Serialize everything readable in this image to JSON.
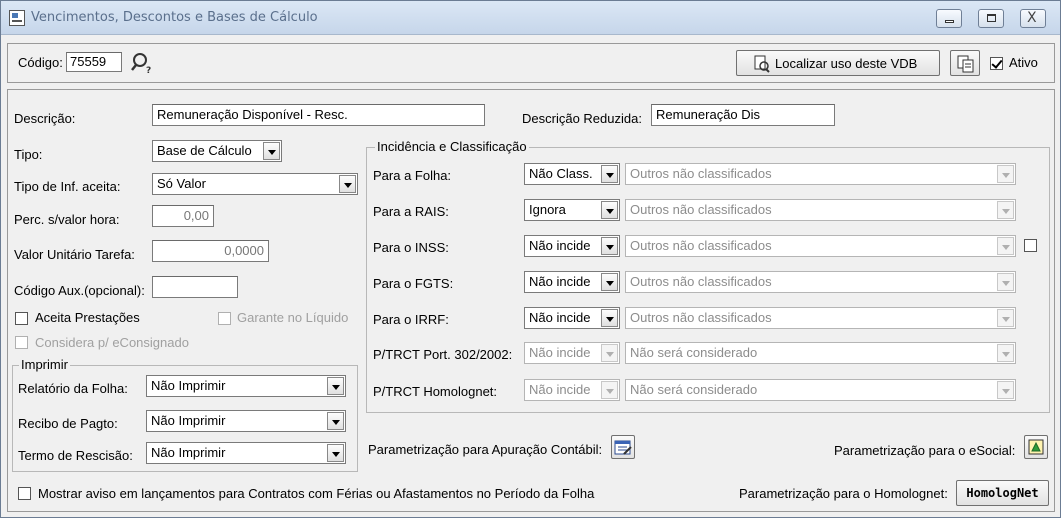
{
  "window": {
    "title": "Vencimentos, Descontos e Bases de Cálculo",
    "minimize": "",
    "maximize": "",
    "close": "X"
  },
  "top": {
    "codigo_label": "Código:",
    "codigo_value": "75559",
    "localizar_label": "Localizar uso deste VDB",
    "ativo_label": "Ativo"
  },
  "form": {
    "descricao_label": "Descrição:",
    "descricao_value": "Remuneração Disponível - Resc.",
    "desc_reduzida_label": "Descrição Reduzida:",
    "desc_reduzida_value": "Remuneração Dis",
    "tipo_label": "Tipo:",
    "tipo_value": "Base de Cálculo",
    "tipo_inf_label": "Tipo de Inf. aceita:",
    "tipo_inf_value": "Só Valor",
    "perc_label": "Perc. s/valor hora:",
    "perc_value": "0,00",
    "valor_unit_label": "Valor Unitário Tarefa:",
    "valor_unit_value": "0,0000",
    "cod_aux_label": "Código Aux.(opcional):",
    "cod_aux_value": "",
    "aceita_prestacoes_label": "Aceita Prestações",
    "garante_liquido_label": "Garante no Líquido",
    "considera_label": "Considera p/ eConsignado"
  },
  "imprimir": {
    "legend": "Imprimir",
    "relatorio_label": "Relatório da Folha:",
    "relatorio_value": "Não Imprimir",
    "recibo_label": "Recibo de Pagto:",
    "recibo_value": "Não Imprimir",
    "termo_label": "Termo de Rescisão:",
    "termo_value": "Não Imprimir"
  },
  "incidencia": {
    "legend": "Incidência e Classificação",
    "rows": [
      {
        "label": "Para a Folha:",
        "value": "Não Class.",
        "class": "Outros não classificados"
      },
      {
        "label": "Para a RAIS:",
        "value": "Ignora",
        "class": "Outros não classificados"
      },
      {
        "label": "Para o INSS:",
        "value": "Não incide",
        "class": "Outros não classificados"
      },
      {
        "label": "Para o FGTS:",
        "value": "Não incide",
        "class": "Outros não classificados"
      },
      {
        "label": "Para o IRRF:",
        "value": "Não incide",
        "class": "Outros não classificados"
      },
      {
        "label": "P/TRCT Port. 302/2002:",
        "value": "Não incide",
        "class": "Não será considerado"
      },
      {
        "label": "P/TRCT Homolognet:",
        "value": "Não incide",
        "class": "Não será considerado"
      }
    ]
  },
  "bottom": {
    "param_contabil_label": "Parametrização para Apuração Contábil:",
    "param_esocial_label": "Parametrização para o eSocial:",
    "mostrar_aviso_label": "Mostrar aviso em lançamentos para Contratos com Férias ou Afastamentos no Período da Folha",
    "param_homolognet_label": "Parametrização para o Homolognet:",
    "homolognet_button": "HomologNet"
  }
}
